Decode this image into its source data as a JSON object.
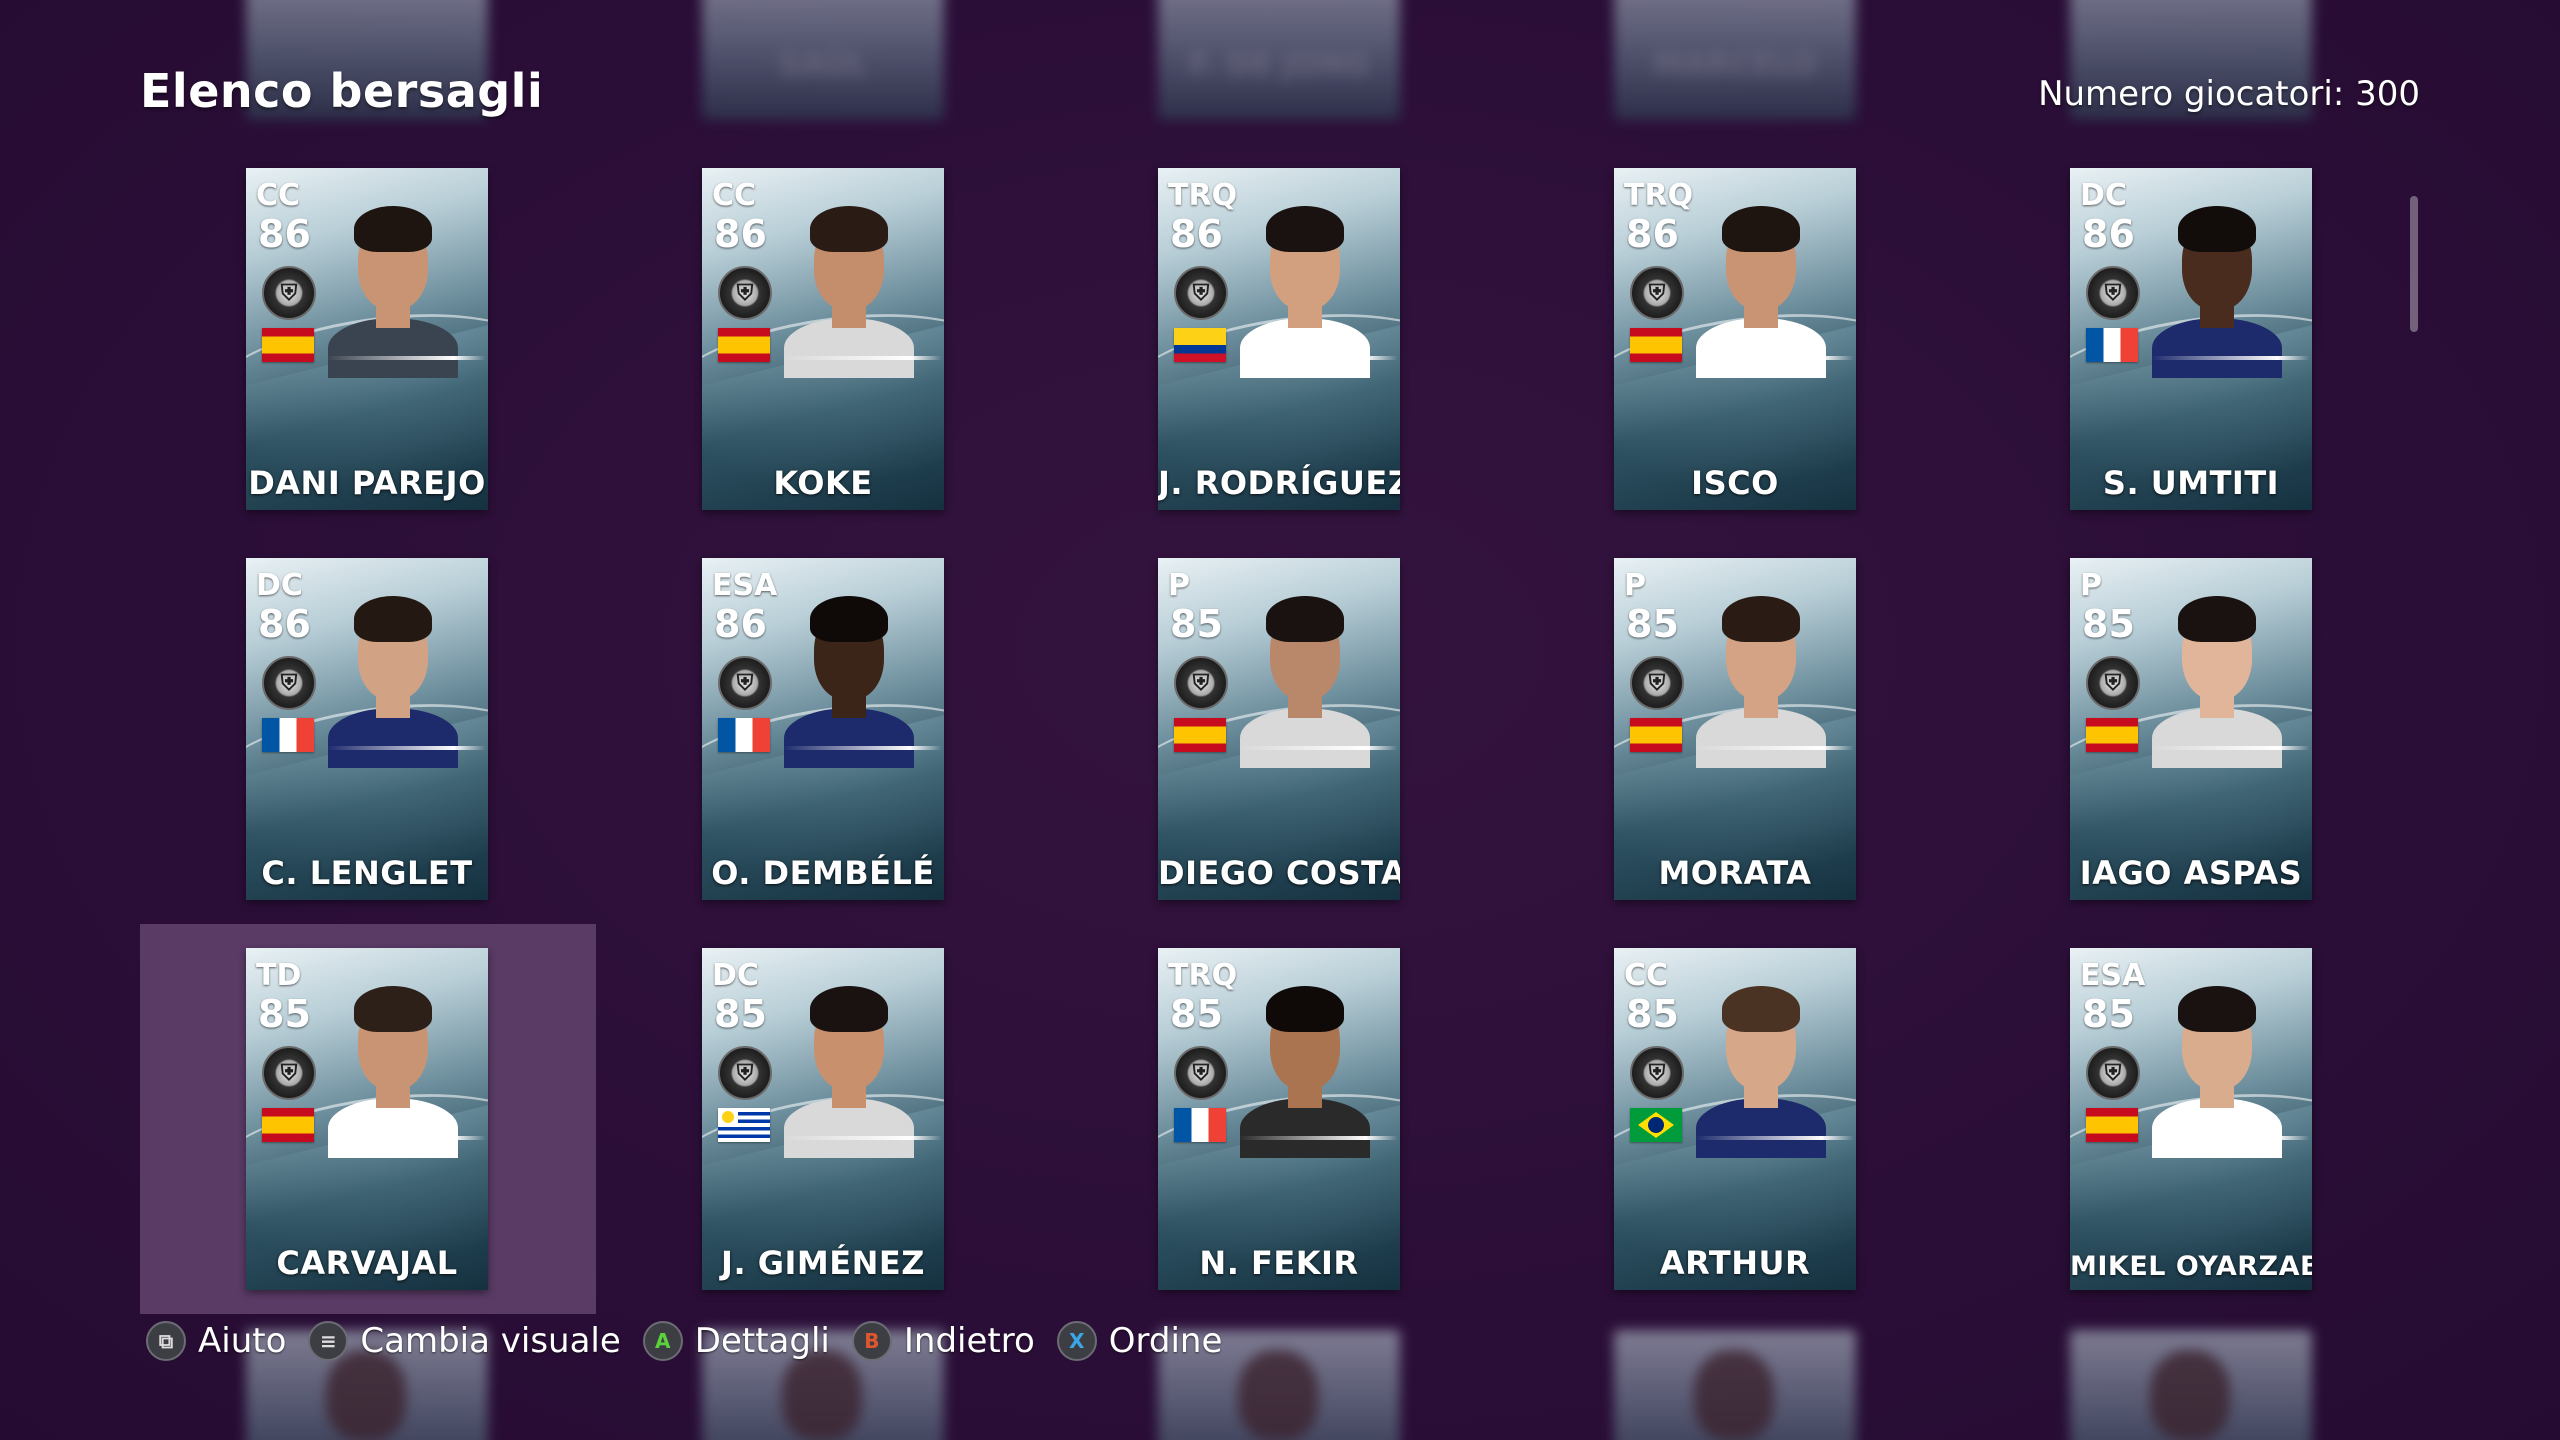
{
  "header": {
    "title": "Elenco bersagli",
    "player_count": "Numero giocatori: 300"
  },
  "ghost_top": [
    "SAÚL",
    "F. DE JONG",
    "MARCELO"
  ],
  "players": [
    {
      "pos": "CC",
      "rating": "86",
      "flag": "es",
      "name": "DANI PAREJO"
    },
    {
      "pos": "CC",
      "rating": "86",
      "flag": "es",
      "name": "KOKE"
    },
    {
      "pos": "TRQ",
      "rating": "86",
      "flag": "co",
      "name": "J. RODRÍGUEZ"
    },
    {
      "pos": "TRQ",
      "rating": "86",
      "flag": "es",
      "name": "ISCO"
    },
    {
      "pos": "DC",
      "rating": "86",
      "flag": "fr",
      "name": "S. UMTITI"
    },
    {
      "pos": "DC",
      "rating": "86",
      "flag": "fr",
      "name": "C. LENGLET"
    },
    {
      "pos": "ESA",
      "rating": "86",
      "flag": "fr",
      "name": "O. DEMBÉLÉ"
    },
    {
      "pos": "P",
      "rating": "85",
      "flag": "es",
      "name": "DIEGO COSTA"
    },
    {
      "pos": "P",
      "rating": "85",
      "flag": "es",
      "name": "MORATA"
    },
    {
      "pos": "P",
      "rating": "85",
      "flag": "es",
      "name": "IAGO ASPAS"
    },
    {
      "pos": "TD",
      "rating": "85",
      "flag": "es",
      "name": "CARVAJAL"
    },
    {
      "pos": "DC",
      "rating": "85",
      "flag": "uy",
      "name": "J. GIMÉNEZ"
    },
    {
      "pos": "TRQ",
      "rating": "85",
      "flag": "fr",
      "name": "N. FEKIR"
    },
    {
      "pos": "CC",
      "rating": "85",
      "flag": "br",
      "name": "ARTHUR"
    },
    {
      "pos": "ESA",
      "rating": "85",
      "flag": "es",
      "name": "MIKEL OYARZABAL"
    }
  ],
  "footer": {
    "help_label": "Aiuto",
    "view_label": "Cambia visuale",
    "details_label": "Dettagli",
    "back_label": "Indietro",
    "sort_label": "Ordine",
    "help_glyph": "⧉",
    "view_glyph": "≡",
    "details_glyph": "A",
    "back_glyph": "B",
    "sort_glyph": "X"
  },
  "selected_index": 10,
  "colors": {
    "background": "#2c0f3a",
    "selection": "#5a3b66",
    "button_a": "#5bd23b",
    "button_b": "#e0562f",
    "button_x": "#3aa6e8"
  }
}
